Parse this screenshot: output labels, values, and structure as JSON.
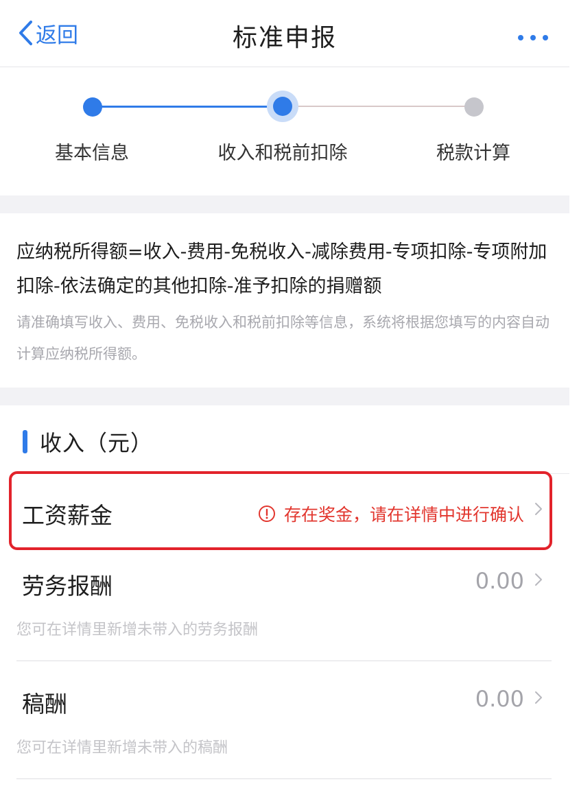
{
  "nav": {
    "back_label": "返回",
    "title": "标准申报"
  },
  "steps": [
    {
      "label": "基本信息",
      "state": "done"
    },
    {
      "label": "收入和税前扣除",
      "state": "current"
    },
    {
      "label": "税款计算",
      "state": "todo"
    }
  ],
  "formula": {
    "text": "应纳税所得额=收入-费用-免税收入-减除费用-专项扣除-专项附加扣除-依法确定的其他扣除-准予扣除的捐赠额",
    "hint": "请准确填写收入、费用、免税收入和税前扣除等信息，系统将根据您填写的内容自动计算应纳税所得额。"
  },
  "income": {
    "section_title": "收入（元）",
    "rows": [
      {
        "label": "工资薪金",
        "alert": "存在奖金，请在详情中进行确认"
      },
      {
        "label": "劳务报酬",
        "value": "0.00",
        "hint": "您可在详情里新增未带入的劳务报酬"
      },
      {
        "label": "稿酬",
        "value": "0.00",
        "hint": "您可在详情里新增未带入的稿酬"
      }
    ]
  },
  "colors": {
    "accent": "#2f7be8",
    "alert": "#e2362e",
    "highlight_border": "#e2232b"
  },
  "icons": [
    "chevron-left-icon",
    "more-dots-icon",
    "alert-circle-icon",
    "chevron-right-icon"
  ]
}
